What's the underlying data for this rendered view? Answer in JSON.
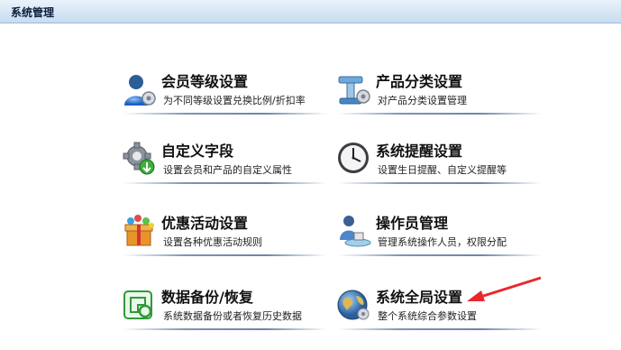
{
  "window": {
    "title": "系统管理"
  },
  "tiles": [
    {
      "title": "会员等级设置",
      "desc": "为不同等级设置兑换比例/折扣率",
      "icon": "member-icon"
    },
    {
      "title": "产品分类设置",
      "desc": "对产品分类设置管理",
      "icon": "category-icon"
    },
    {
      "title": "自定义字段",
      "desc": "设置会员和产品的自定义属性",
      "icon": "gear-icon"
    },
    {
      "title": "系统提醒设置",
      "desc": "设置生日提醒、自定义提醒等",
      "icon": "clock-icon"
    },
    {
      "title": "优惠活动设置",
      "desc": "设置各种优惠活动规则",
      "icon": "gift-icon"
    },
    {
      "title": "操作员管理",
      "desc": "管理系统操作人员，权限分配",
      "icon": "operator-icon"
    },
    {
      "title": "数据备份/恢复",
      "desc": "系统数据备份或者恢复历史数据",
      "icon": "backup-icon"
    },
    {
      "title": "系统全局设置",
      "desc": "整个系统综合参数设置",
      "icon": "globe-icon"
    }
  ],
  "colors": {
    "arrow": "#e8282d",
    "title_bar": "#d6e5f5"
  }
}
